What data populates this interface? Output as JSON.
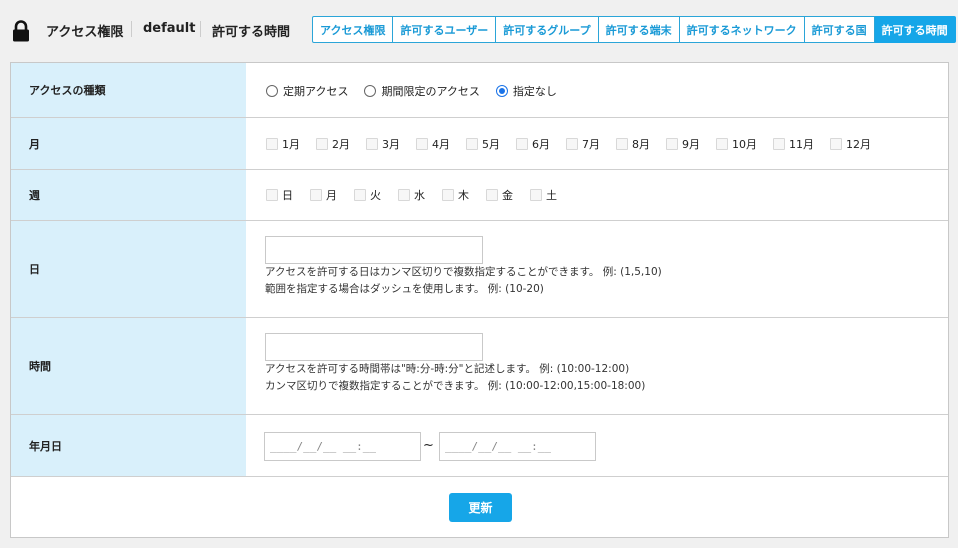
{
  "header": {
    "icon": "lock-icon",
    "breadcrumb": [
      "アクセス権限",
      "default",
      "許可する時間"
    ]
  },
  "tabs": [
    {
      "label": "アクセス権限",
      "active": false
    },
    {
      "label": "許可するユーザー",
      "active": false
    },
    {
      "label": "許可するグループ",
      "active": false
    },
    {
      "label": "許可する端末",
      "active": false
    },
    {
      "label": "許可するネットワーク",
      "active": false
    },
    {
      "label": "許可する国",
      "active": false
    },
    {
      "label": "許可する時間",
      "active": true
    }
  ],
  "form": {
    "access_type": {
      "label": "アクセスの種類",
      "options": [
        "定期アクセス",
        "期間限定のアクセス",
        "指定なし"
      ],
      "selected": "指定なし"
    },
    "month": {
      "label": "月",
      "options": [
        "1月",
        "2月",
        "3月",
        "4月",
        "5月",
        "6月",
        "7月",
        "8月",
        "9月",
        "10月",
        "11月",
        "12月"
      ]
    },
    "week": {
      "label": "週",
      "options": [
        "日",
        "月",
        "火",
        "水",
        "木",
        "金",
        "土"
      ]
    },
    "day": {
      "label": "日",
      "value": "",
      "help1": "アクセスを許可する日はカンマ区切りで複数指定することができます。 例: (1,5,10)",
      "help2": "範囲を指定する場合はダッシュを使用します。 例: (10-20)"
    },
    "time": {
      "label": "時間",
      "value": "",
      "help1": "アクセスを許可する時間帯は\"時:分-時:分\"と記述します。 例: (10:00-12:00)",
      "help2": "カンマ区切りで複数指定することができます。 例: (10:00-12:00,15:00-18:00)"
    },
    "date_range": {
      "label": "年月日",
      "from_placeholder": "____/__/__ __:__",
      "to_placeholder": "____/__/__ __:__",
      "separator": "~"
    }
  },
  "update_button": "更新"
}
